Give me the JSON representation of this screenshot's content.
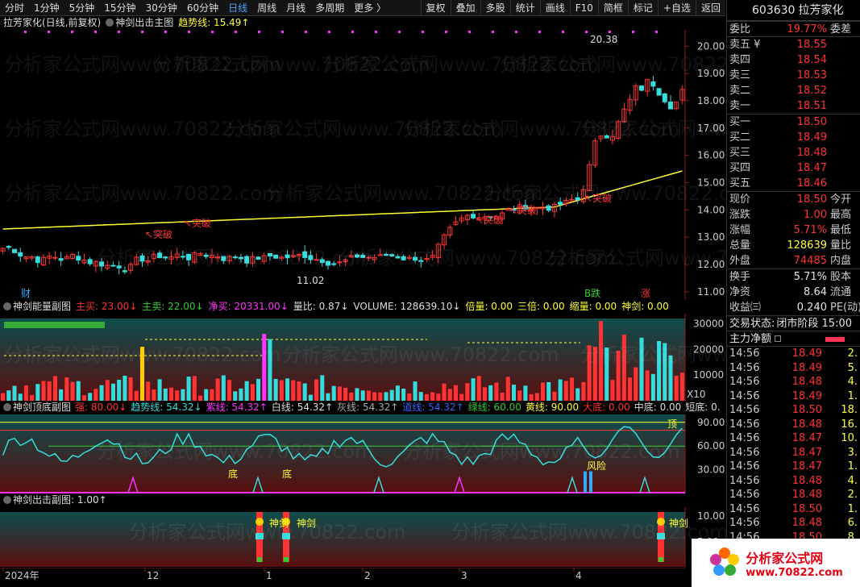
{
  "toolbar": {
    "periods": [
      "分时",
      "1分钟",
      "5分钟",
      "15分钟",
      "30分钟",
      "60分钟",
      "日线",
      "周线",
      "月线",
      "多周期",
      "更多 〉"
    ],
    "active": "日线",
    "actions": [
      "复权",
      "叠加",
      "多股",
      "统计",
      "画线",
      "F10",
      "简框",
      "标记",
      "+自选",
      "返回"
    ]
  },
  "main_chart": {
    "stock_label": "拉芳家化(日线,前复权)",
    "indicator_name": "神剑出击主图",
    "trend_label": "趋势线: 15.49↑",
    "high_label": "20.38",
    "low_label": "11.02",
    "breakout_label": "突破",
    "y_ticks": [
      "20.00",
      "19.00",
      "18.00",
      "17.00",
      "16.00",
      "15.00",
      "14.00",
      "13.00",
      "12.00",
      "11.00"
    ],
    "badge_cai": "财",
    "badge_jie": "B跌",
    "badge_zhang": "涨"
  },
  "sub1": {
    "name": "神剑能量副图",
    "zhu_mai": "主买: 23.00↓",
    "zhu_mai_sell": "主卖: 22.00↓",
    "jing_mai": "净买: 20331.00↓",
    "liang_bi": "量比: 0.87↓",
    "volume": "VOLUME: 128639.10↓",
    "bei_liang": "倍量: 0.00",
    "san_bei": "三倍: 0.00",
    "suo_liang": "缩量: 0.00",
    "shen_jian": "神剑: 0.00",
    "y_ticks": [
      "30000",
      "20000",
      "10000"
    ],
    "unit": "X10"
  },
  "sub2": {
    "name": "神剑顶底副图",
    "qiang": "强: 80.00↓",
    "qushi": "趋势线: 54.32↓",
    "zi_xian": "紫线: 54.32↑",
    "bai_xian": "白线: 54.32↑",
    "hui_xian": "灰线: 54.32↑",
    "dao_xian": "道线: 54.32↑",
    "lv_xian": "绿线: 60.00",
    "huang_xian": "黄线: 90.00",
    "da_di": "大底: 0.00",
    "zhong_di": "中底: 0.00",
    "duan_di": "短底: 0.",
    "y_ticks": [
      "90.00",
      "60.00",
      "30.00"
    ],
    "label_di": "底",
    "label_ding": "顶",
    "label_rising": "风险"
  },
  "sub3": {
    "name": "神剑出击副图",
    "value": ": 1.00↑",
    "label": "神剑",
    "y_ticks": [
      "10.00",
      "5.00"
    ]
  },
  "x_axis": [
    "2024年",
    "12",
    "1",
    "2",
    "3",
    "4"
  ],
  "quote": {
    "code": "603630",
    "name": "拉芳家化",
    "wei_bi_label": "委比",
    "wei_bi": "19.77%",
    "wei_cha_label": "委差",
    "asks": [
      {
        "label": "卖五 ¥",
        "price": "18.55"
      },
      {
        "label": "卖四",
        "price": "18.54"
      },
      {
        "label": "卖三",
        "price": "18.53"
      },
      {
        "label": "卖二",
        "price": "18.52"
      },
      {
        "label": "卖一",
        "price": "18.51"
      }
    ],
    "bids": [
      {
        "label": "买一",
        "price": "18.50"
      },
      {
        "label": "买二",
        "price": "18.49"
      },
      {
        "label": "买三",
        "price": "18.48"
      },
      {
        "label": "买四",
        "price": "18.47"
      },
      {
        "label": "买五",
        "price": "18.46"
      }
    ],
    "stats": [
      {
        "label": "现价",
        "value": "18.50",
        "tail": "今开",
        "cls": "red"
      },
      {
        "label": "涨跌",
        "value": "1.00",
        "tail": "最高",
        "cls": "red"
      },
      {
        "label": "涨幅",
        "value": "5.71%",
        "tail": "最低",
        "cls": "red"
      },
      {
        "label": "总量",
        "value": "128639",
        "tail": "量比",
        "cls": "yellow"
      },
      {
        "label": "外盘",
        "value": "74485",
        "tail": "内盘",
        "cls": "red"
      }
    ],
    "stats2": [
      {
        "label": "换手",
        "value": "5.71%",
        "tail": "股本",
        "cls": "white"
      },
      {
        "label": "净资",
        "value": "8.64",
        "tail": "流通",
        "cls": "white"
      },
      {
        "label": "收益㈢",
        "value": "0.240",
        "tail": "PE(动)",
        "cls": "white"
      }
    ],
    "trade_status_label": "交易状态:",
    "trade_status": "闭市阶段 15:00",
    "net_flow_label": "主力净额",
    "trades": [
      {
        "t": "14:56",
        "p": "18.49",
        "v": "2."
      },
      {
        "t": "14:56",
        "p": "18.49",
        "v": "5."
      },
      {
        "t": "14:56",
        "p": "18.48",
        "v": "4."
      },
      {
        "t": "14:56",
        "p": "18.49",
        "v": "1."
      },
      {
        "t": "14:56",
        "p": "18.50",
        "v": "18."
      },
      {
        "t": "14:56",
        "p": "18.48",
        "v": "16."
      },
      {
        "t": "14:56",
        "p": "18.47",
        "v": "10."
      },
      {
        "t": "14:56",
        "p": "18.47",
        "v": "3."
      },
      {
        "t": "14:56",
        "p": "18.47",
        "v": "1."
      },
      {
        "t": "14:56",
        "p": "18.48",
        "v": "4."
      },
      {
        "t": "14:56",
        "p": "18.48",
        "v": "2."
      },
      {
        "t": "14:56",
        "p": "18.50",
        "v": "1."
      },
      {
        "t": "14:56",
        "p": "18.48",
        "v": "6."
      },
      {
        "t": "14:56",
        "p": "18.50",
        "v": "8."
      }
    ]
  },
  "logo": {
    "title": "分析家公式网",
    "url": "www.70822.com"
  },
  "watermark": "分析家公式网www.70822.com"
}
